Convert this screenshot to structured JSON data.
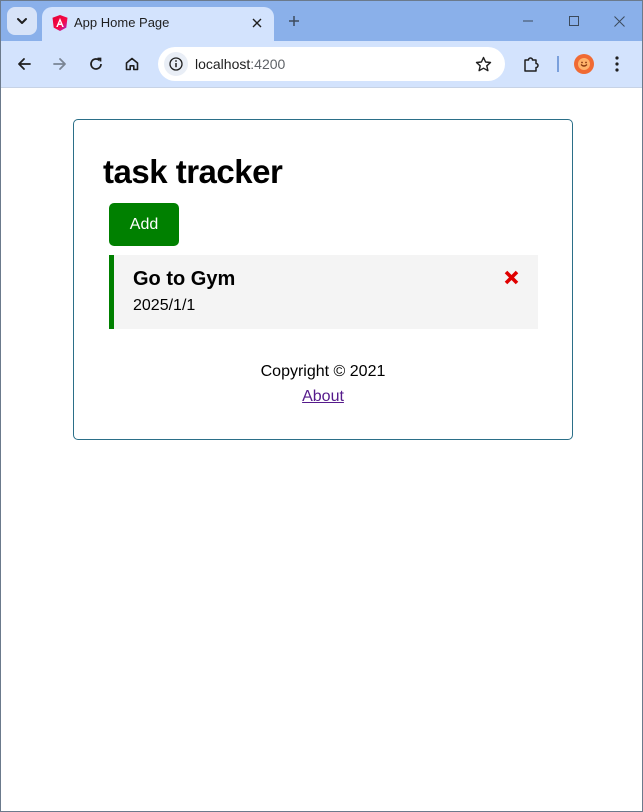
{
  "browser": {
    "tab": {
      "title": "App Home Page",
      "favicon": "angular-icon"
    },
    "address": {
      "host": "localhost",
      "port": ":4200"
    }
  },
  "app": {
    "title": "task tracker",
    "add_label": "Add",
    "tasks": [
      {
        "text": "Go to Gym",
        "day": "2025/1/1",
        "reminder": true
      }
    ],
    "footer": {
      "copyright": "Copyright © 2021",
      "about_label": "About"
    }
  },
  "colors": {
    "primary": "#008000",
    "delete": "#e00000",
    "container_border": "#2b6f88",
    "link": "#551a8b"
  }
}
